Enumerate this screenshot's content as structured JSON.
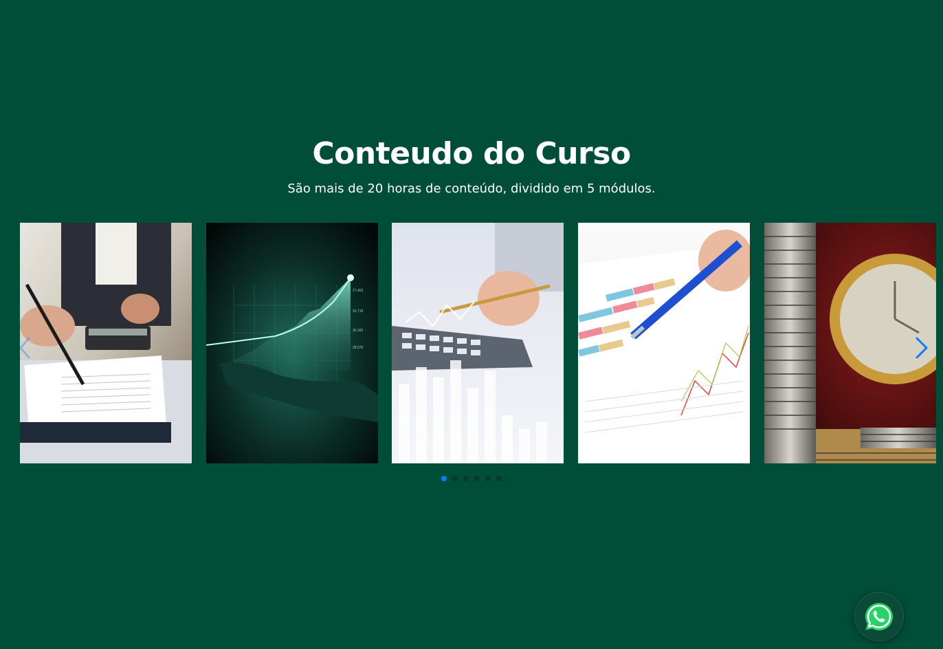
{
  "section": {
    "title": "Conteudo do Curso",
    "subtitle": "São mais de 20 horas de conteúdo, dividido em 5 módulos."
  },
  "carousel": {
    "slides": [
      {
        "image": "accounting-documents-calculator"
      },
      {
        "image": "financial-growth-chart-hand"
      },
      {
        "image": "calculator-pen-analytics"
      },
      {
        "image": "pen-bar-chart-report"
      },
      {
        "image": "coin-stacks-clock"
      }
    ],
    "prev_icon": "chevron-left-icon",
    "next_icon": "chevron-right-icon",
    "page_count": 6,
    "active_page": 1
  },
  "colors": {
    "background": "#004d38",
    "text": "#ffffff",
    "accent": "#0a7cff",
    "whatsapp": "#25d366"
  },
  "floating_button": {
    "icon": "whatsapp-icon"
  }
}
